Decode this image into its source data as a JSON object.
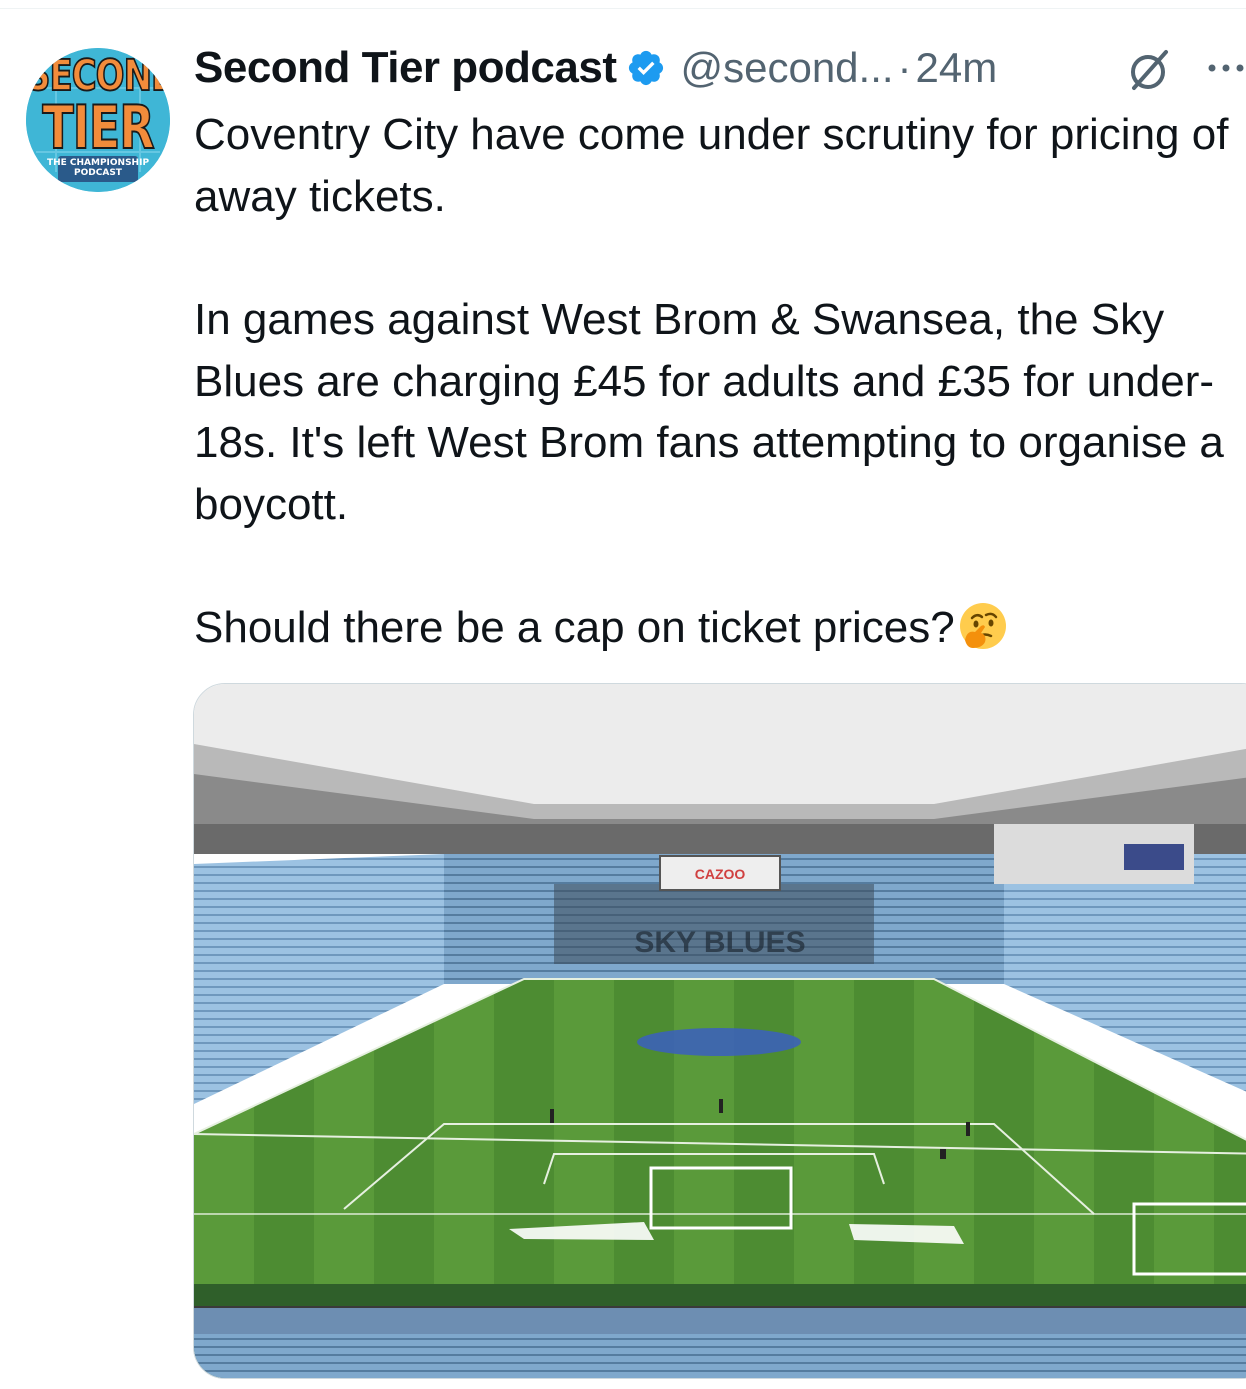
{
  "post": {
    "author_name": "Second Tier podcast",
    "handle": "@second...",
    "separator": "·",
    "time": "24m",
    "avatar": {
      "line1": "SECOND",
      "line2": "TIER",
      "caption_line1": "THE CHAMPIONSHIP",
      "caption_line2": "PODCAST"
    },
    "icons": {
      "verified": "verified-badge-icon",
      "grok": "grok-icon",
      "more": "more-options-icon"
    },
    "paragraphs": [
      "Coventry City have come under scrutiny for pricing of away tickets.",
      "In games against West Brom & Swansea, the Sky Blues are charging £45 for adults and £35 for under-18s. It's left West Brom fans attempting to organise a boycott.",
      "Should there be a cap on ticket prices?"
    ],
    "emoji": "🤔",
    "media": {
      "scoreboard_text": "CAZOO",
      "stand_letters": "SKY BLUES"
    }
  },
  "colors": {
    "accent": "#1d9bf0",
    "text": "#0f1419",
    "secondary": "#536471",
    "avatar_bg": "#3fb6d6",
    "avatar_text": "#f28c3b",
    "pitch_light": "#5a9a3a",
    "pitch_dark": "#4a8a30",
    "seat_blue": "#8fb8dc"
  }
}
